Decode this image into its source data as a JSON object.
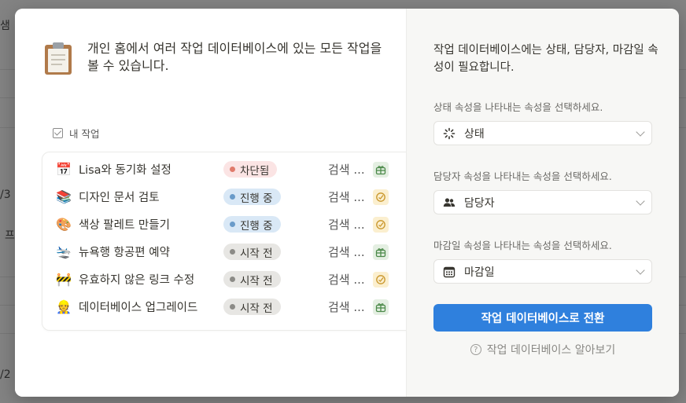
{
  "background": {
    "fragments": [
      "샘",
      "/3",
      "프",
      "/2"
    ]
  },
  "intro": {
    "text": "개인 홈에서 여러 작업 데이터베이스에 있는 모든 작업을 볼 수 있습니다.",
    "icon": "clipboard-icon"
  },
  "tasks_header": {
    "label": "내 작업"
  },
  "tasks": [
    {
      "emoji": "📅",
      "icon": "calendar-icon",
      "name": "Lisa와 동기화 설정",
      "status": "차단됨",
      "status_color": "red",
      "search": "검색 ...",
      "action_icon": "gift-icon"
    },
    {
      "emoji": "📚",
      "icon": "books-icon",
      "name": "디자인 문서 검토",
      "status": "진행 중",
      "status_color": "blue",
      "search": "검색 ...",
      "action_icon": "target-icon"
    },
    {
      "emoji": "🎨",
      "icon": "palette-icon",
      "name": "색상 팔레트 만들기",
      "status": "진행 중",
      "status_color": "blue",
      "search": "검색 ...",
      "action_icon": "target-icon"
    },
    {
      "emoji": "🛬",
      "icon": "airplane-icon",
      "name": "뉴욕행 항공편 예약",
      "status": "시작 전",
      "status_color": "gray",
      "search": "검색 ...",
      "action_icon": "gift-icon"
    },
    {
      "emoji": "🚧",
      "icon": "construction-icon",
      "name": "유효하지 않은 링크 수정",
      "status": "시작 전",
      "status_color": "gray",
      "search": "검색 ...",
      "action_icon": "target-icon"
    },
    {
      "emoji": "👷",
      "icon": "worker-icon",
      "name": "데이터베이스 업그레이드",
      "status": "시작 전",
      "status_color": "gray",
      "search": "검색 ...",
      "action_icon": "gift-icon"
    }
  ],
  "panel": {
    "title": "작업 데이터베이스에는 상태, 담당자, 마감일 속성이 필요합니다.",
    "status_label": "상태 속성을 나타내는 속성을 선택하세요.",
    "status_value": "상태",
    "assignee_label": "담당자 속성을 나타내는 속성을 선택하세요.",
    "assignee_value": "담당자",
    "due_label": "마감일 속성을 나타내는 속성을 선택하세요.",
    "due_value": "마감일",
    "convert_button": "작업 데이터베이스로 전환",
    "learn_more": "작업 데이터베이스 알아보기"
  },
  "colors": {
    "primary_button": "#2f80dd",
    "badge_red": "#fbe4e4",
    "badge_blue": "#d9e8f6",
    "badge_gray": "#e7e6e3"
  }
}
